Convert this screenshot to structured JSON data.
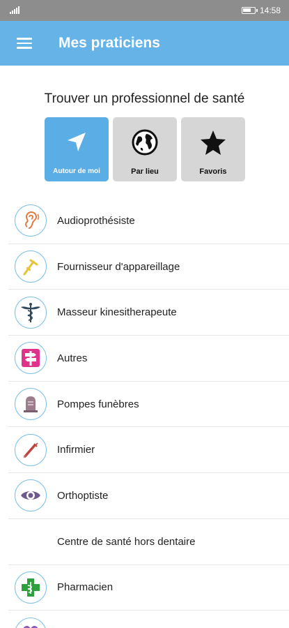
{
  "status_bar": {
    "time": "14:58"
  },
  "app_bar": {
    "title": "Mes praticiens"
  },
  "search": {
    "title": "Trouver un professionnel de santé",
    "modes": [
      {
        "label": "Autour de moi",
        "icon": "navigation-arrow-icon",
        "active": true
      },
      {
        "label": "Par lieu",
        "icon": "globe-icon",
        "active": false
      },
      {
        "label": "Favoris",
        "icon": "star-icon",
        "active": false
      }
    ]
  },
  "practitioners": [
    {
      "label": "Audioprothésiste",
      "icon": "ear-icon",
      "color": "#e07a3f"
    },
    {
      "label": "Fournisseur d'appareillage",
      "icon": "crutch-icon",
      "color": "#e8c23a"
    },
    {
      "label": "Masseur kinesitherapeute",
      "icon": "caduceus-icon",
      "color": "#2f4a5e"
    },
    {
      "label": "Autres",
      "icon": "signpost-icon",
      "color": "#e0328a"
    },
    {
      "label": "Pompes funèbres",
      "icon": "tombstone-icon",
      "color": "#8a6a7a"
    },
    {
      "label": "Infirmier",
      "icon": "syringe-icon",
      "color": "#c0443c"
    },
    {
      "label": "Orthoptiste",
      "icon": "eye-icon",
      "color": "#6e5a8c"
    },
    {
      "label": "Centre de santé hors dentaire",
      "icon": "",
      "color": ""
    },
    {
      "label": "Pharmacien",
      "icon": "pharmacy-cross-icon",
      "color": "#2e9e3e"
    },
    {
      "label": "",
      "icon": "heart-icon",
      "color": "#8a5ab4"
    }
  ]
}
